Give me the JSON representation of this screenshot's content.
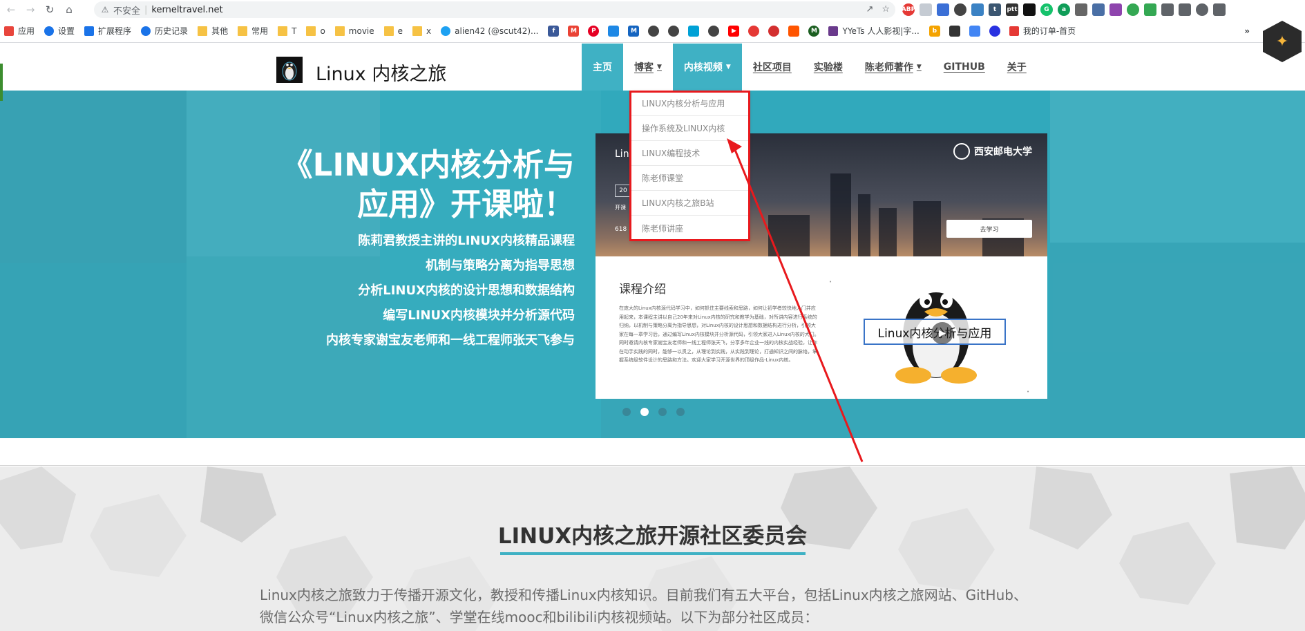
{
  "browser": {
    "back_icon": "arrow-left-icon",
    "forward_icon": "arrow-right-icon",
    "reload_icon": "reload-icon",
    "home_icon": "home-icon",
    "security_label": "不安全",
    "url": "kerneltravel.net",
    "bookmarks": [
      {
        "label": "应用",
        "icon": "apps-grid-icon",
        "color": "#e8453c"
      },
      {
        "label": "设置",
        "icon": "gear-icon",
        "color": "#1a73e8"
      },
      {
        "label": "扩展程序",
        "icon": "puzzle-icon",
        "color": "#1a73e8"
      },
      {
        "label": "历史记录",
        "icon": "history-icon",
        "color": "#1a73e8"
      },
      {
        "label": "其他",
        "icon": "folder-icon",
        "color": "#f6c244"
      },
      {
        "label": "常用",
        "icon": "folder-icon",
        "color": "#f6c244"
      },
      {
        "label": "T",
        "icon": "folder-icon",
        "color": "#f6c244"
      },
      {
        "label": "o",
        "icon": "folder-icon",
        "color": "#f6c244"
      },
      {
        "label": "movie",
        "icon": "folder-icon",
        "color": "#f6c244"
      },
      {
        "label": "e",
        "icon": "folder-icon",
        "color": "#f6c244"
      },
      {
        "label": "x",
        "icon": "folder-icon",
        "color": "#f6c244"
      },
      {
        "label": "alien42 (@scut42)...",
        "icon": "twitter-icon",
        "color": "#1da1f2"
      }
    ],
    "bookmarks_tail": [
      {
        "label": "YYeTs 人人影视|字...",
        "icon": "yyets-icon",
        "color": "#6a3a8c"
      },
      {
        "label": "我的订单-首页",
        "icon": "order-icon",
        "color": "#e53935"
      }
    ],
    "more_label": "»"
  },
  "site": {
    "title": "Linux 内核之旅",
    "logo_icon": "tux-logo-icon",
    "nav": [
      {
        "label": "主页",
        "state": "active",
        "has_caret": false
      },
      {
        "label": "博客",
        "state": "normal",
        "has_caret": true
      },
      {
        "label": "内核视频",
        "state": "open",
        "has_caret": true
      },
      {
        "label": "社区项目",
        "state": "normal",
        "has_caret": false
      },
      {
        "label": "实验楼",
        "state": "normal",
        "has_caret": false
      },
      {
        "label": "陈老师著作",
        "state": "normal",
        "has_caret": true
      },
      {
        "label": "GITHUB",
        "state": "normal",
        "has_caret": false
      },
      {
        "label": "关于",
        "state": "normal",
        "has_caret": false
      }
    ],
    "dropdown": [
      "LINUX内核分析与应用",
      "操作系统及LINUX内核",
      "LINUX编程技术",
      "陈老师课堂",
      "LINUX内核之旅B站",
      "陈老师讲座"
    ]
  },
  "hero": {
    "title_line1": "《LINUX内核分析与",
    "title_line2": "应用》开课啦！",
    "lines": [
      "陈莉君教授主讲的LINUX内核精品课程",
      "机制与策略分离为指导思想",
      "分析LINUX内核的设计思想和数据结构",
      "编写LINUX内核模块并分析源代码",
      "内核专家谢宝友老师和一线工程师张天飞参与"
    ],
    "card": {
      "banner_title": "Lin",
      "box_text": "20",
      "kai_text": "开课",
      "num_text": "618",
      "university": "西安邮电大学",
      "button": "去学习",
      "intro_title": "课程介绍",
      "intro_text": "在庞大的Linux内核源代码学习中，如何抓住主要线索和思路，如何让初学者较快地入门并应用起来，本课程主讲以自己20年来对Linux内核的研究和教学为基础，对所讲内容进行系统的归纳，以机制与策略分离为指导思想，对Linux内核的设计思想和数据结构进行分析，引领大家在每一章学习后，通过编写Linux内核模块并分析源代码，引领大家进入Linux内核的大门。同时邀请内核专家谢宝友老师和一线工程师张天飞，分享多年企业一线的内核实战经验，让你在动手实践的同时，能够一以贯之，从理论到实践，从实践到理论，打通知识之间的脉络，掌握系统级软件设计的思路和方法。欢迎大家学习开源世界的顶级作品-Linux内核。",
      "video_label": "Linux内核分析与应用"
    },
    "slide_count": 4,
    "active_slide": 1
  },
  "community": {
    "title": "LINUX内核之旅开源社区委员会",
    "text_line1": "Linux内核之旅致力于传播开源文化，教授和传播Linux内核知识。目前我们有五大平台，包括Linux内核之旅网站、GitHub、",
    "text_line2": "微信公众号“Linux内核之旅”、学堂在线mooc和bilibili内核视频站。以下为部分社区成员："
  },
  "colors": {
    "accent": "#3fb1c4",
    "annotation_red": "#e8191d"
  }
}
